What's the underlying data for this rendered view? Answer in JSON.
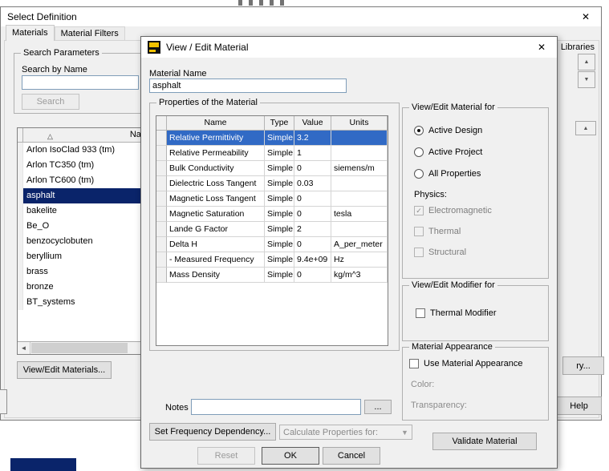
{
  "icons": {
    "close": "✕",
    "sort_triangle": "△",
    "scroll_left_arrow": "◄",
    "up_arrow": "▲",
    "down_arrow": "▼",
    "dropdown_arrow": "▼",
    "checkmark": "✓"
  },
  "colors": {
    "list_selection": "#0a246a",
    "grid_selection": "#316ac5"
  },
  "select_definition": {
    "title": "Select Definition",
    "tabs": [
      {
        "label": "Materials",
        "active": true
      },
      {
        "label": "Material Filters",
        "active": false
      }
    ],
    "search": {
      "legend": "Search Parameters",
      "by_name_label": "Search by Name",
      "input_value": "",
      "button_label": "Search"
    },
    "materials": {
      "name_header": "Name",
      "rows": [
        "Arlon IsoClad 933 (tm)",
        "Arlon TC350 (tm)",
        "Arlon TC600 (tm)",
        "asphalt",
        "bakelite",
        "Be_O",
        "benzocyclobuten",
        "beryllium",
        "brass",
        "bronze",
        "BT_systems"
      ],
      "selected": "asphalt"
    },
    "view_edit_materials_button": "View/Edit Materials...",
    "libraries_label": "Libraries",
    "library_button_fragment": "ry...",
    "help_button": "Help"
  },
  "modal": {
    "title": "View / Edit Material",
    "material_name_label": "Material Name",
    "material_name_value": "asphalt",
    "properties_legend": "Properties of the Material",
    "table": {
      "columns": [
        "Name",
        "Type",
        "Value",
        "Units"
      ],
      "rows": [
        {
          "name": "Relative Permittivity",
          "type": "Simple",
          "value": "3.2",
          "units": "",
          "selected": true
        },
        {
          "name": "Relative Permeability",
          "type": "Simple",
          "value": "1",
          "units": "",
          "selected": false
        },
        {
          "name": "Bulk Conductivity",
          "type": "Simple",
          "value": "0",
          "units": "siemens/m",
          "selected": false
        },
        {
          "name": "Dielectric Loss Tangent",
          "type": "Simple",
          "value": "0.03",
          "units": "",
          "selected": false
        },
        {
          "name": "Magnetic Loss Tangent",
          "type": "Simple",
          "value": "0",
          "units": "",
          "selected": false
        },
        {
          "name": "Magnetic Saturation",
          "type": "Simple",
          "value": "0",
          "units": "tesla",
          "selected": false
        },
        {
          "name": "Lande G Factor",
          "type": "Simple",
          "value": "2",
          "units": "",
          "selected": false
        },
        {
          "name": "Delta H",
          "type": "Simple",
          "value": "0",
          "units": "A_per_meter",
          "selected": false
        },
        {
          "name": "- Measured Frequency",
          "type": "Simple",
          "value": "9.4e+09",
          "units": "Hz",
          "selected": false
        },
        {
          "name": "Mass Density",
          "type": "Simple",
          "value": "0",
          "units": "kg/m^3",
          "selected": false
        }
      ]
    },
    "view_edit_for": {
      "legend": "View/Edit Material for",
      "radios": [
        {
          "label": "Active Design",
          "selected": true
        },
        {
          "label": "Active Project",
          "selected": false
        },
        {
          "label": "All Properties",
          "selected": false
        }
      ],
      "physics_label": "Physics:",
      "physics_checkboxes": [
        {
          "label": "Electromagnetic",
          "checked": true,
          "disabled": true
        },
        {
          "label": "Thermal",
          "checked": false,
          "disabled": true
        },
        {
          "label": "Structural",
          "checked": false,
          "disabled": true
        }
      ]
    },
    "modifier": {
      "legend": "View/Edit Modifier for",
      "checkbox_label": "Thermal Modifier",
      "checked": false
    },
    "appearance": {
      "legend": "Material Appearance",
      "checkbox_label": "Use Material Appearance",
      "checked": false,
      "color_label": "Color:",
      "transparency_label": "Transparency:"
    },
    "validate_button": "Validate Material",
    "notes_label": "Notes",
    "notes_value": "",
    "browse_button": "...",
    "set_frequency_button": "Set Frequency Dependency...",
    "calculate_properties_label": "Calculate Properties for:",
    "reset_button": "Reset",
    "ok_button": "OK",
    "cancel_button": "Cancel"
  }
}
